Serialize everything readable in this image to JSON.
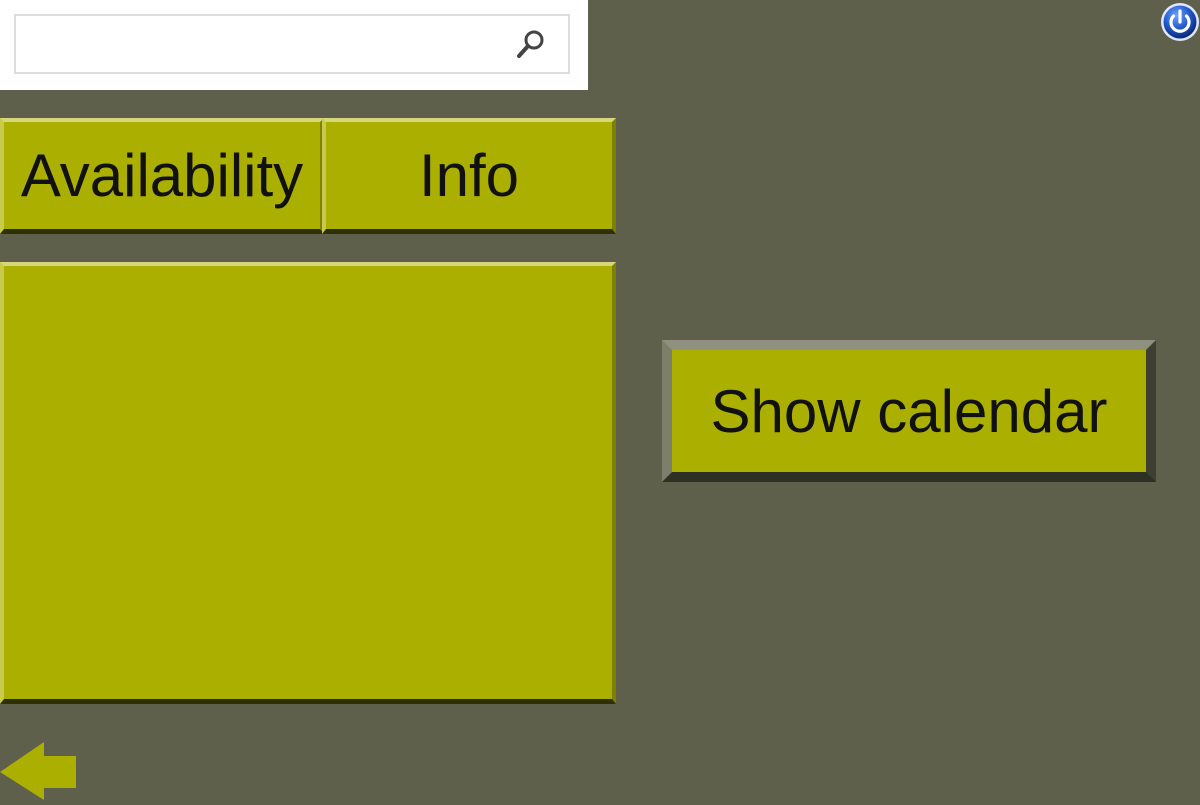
{
  "search": {
    "value": "",
    "placeholder": "",
    "icon": "search-icon"
  },
  "header": {
    "power_icon": "power-icon"
  },
  "tabs": [
    {
      "label": "Availability"
    },
    {
      "label": "Info"
    }
  ],
  "main": {
    "show_calendar_label": "Show calendar"
  },
  "footer": {
    "back_icon": "back-arrow-icon"
  },
  "colors": {
    "background": "#5e604b",
    "accent": "#abb000",
    "power_blue": "#1e56c8"
  }
}
